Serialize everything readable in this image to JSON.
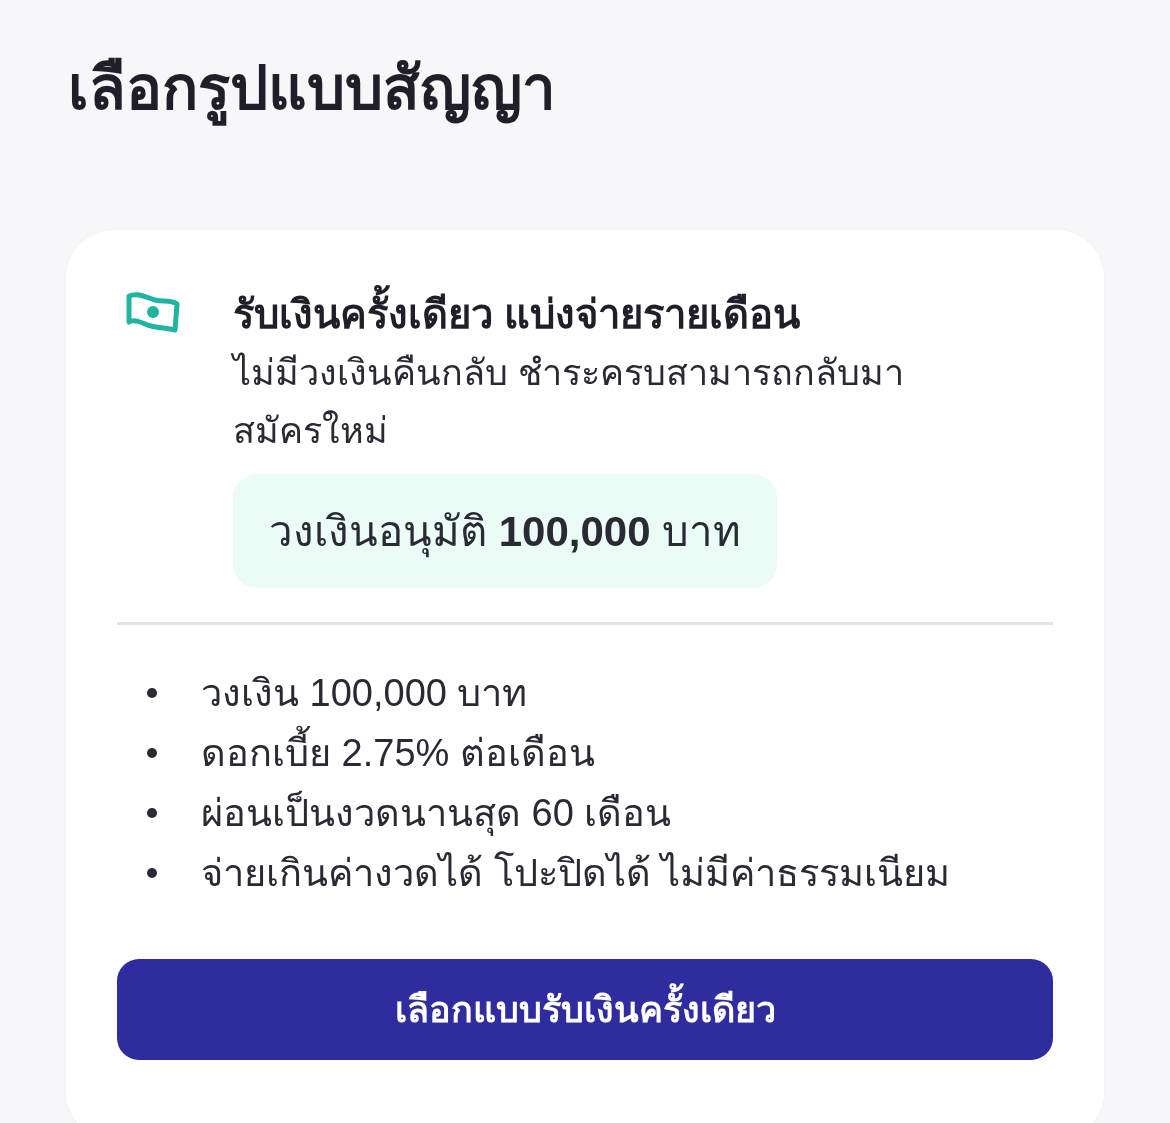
{
  "page": {
    "title": "เลือกรูปแบบสัญญา"
  },
  "plan_card": {
    "title": "รับเงินครั้งเดียว แบ่งจ่ายรายเดือน",
    "description": "ไม่มีวงเงินคืนกลับ ชำระครบสามารถกลับมาสมัครใหม่",
    "approved_limit": "วงเงินอนุมัติ **100,000** บาท",
    "features": [
      "วงเงิน 100,000 บาท",
      "ดอกเบี้ย 2.75% ต่อเดือน",
      "ผ่อนเป็นงวดนานสุด 60 เดือน",
      "จ่ายเกินค่างวดได้ โปะปิดได้ ไม่มีค่าธรรมเนียม"
    ],
    "button": "เลือกแบบรับเงินครั้งเดียว"
  }
}
